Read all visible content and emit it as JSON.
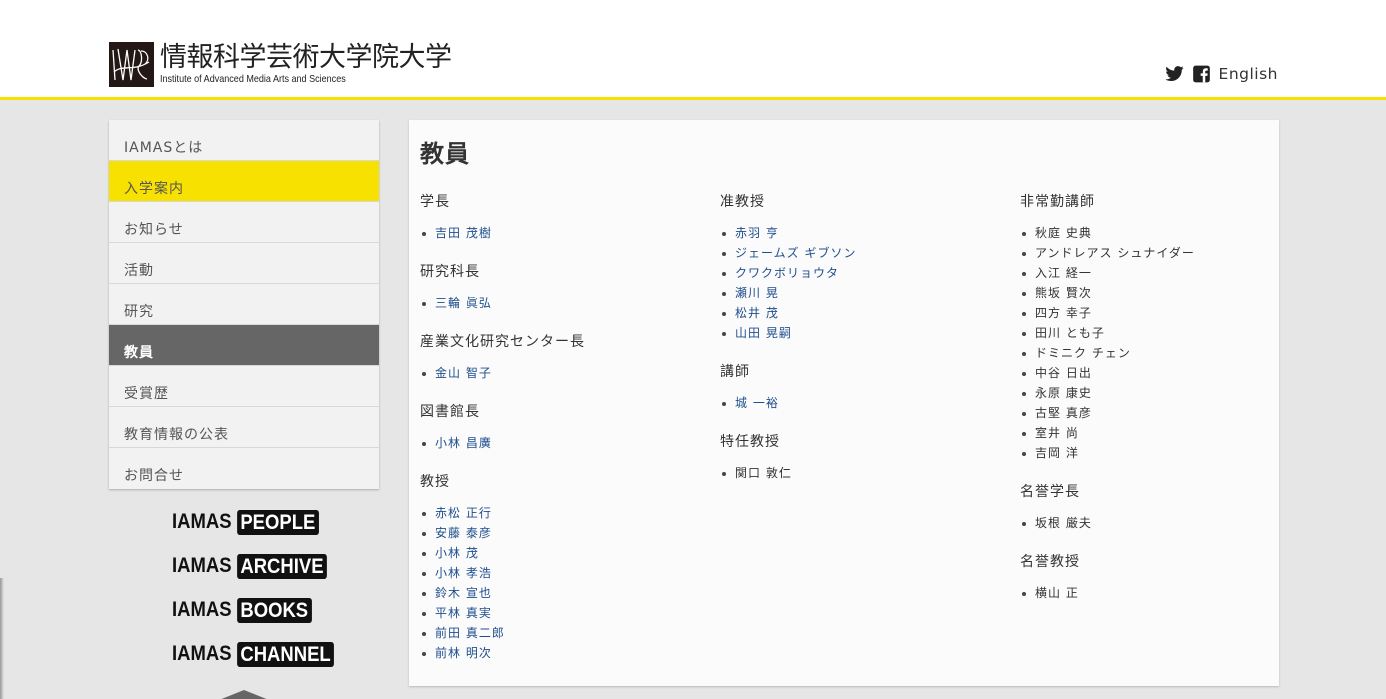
{
  "header": {
    "logo_jp": "情報科学芸術大学院大学",
    "logo_en": "Institute of Advanced Media Arts and Sciences",
    "english_link": "English",
    "icons": [
      "twitter-icon",
      "facebook-icon"
    ]
  },
  "sidebar": {
    "items": [
      {
        "label": "IAMASとは"
      },
      {
        "label": "入学案内"
      },
      {
        "label": "お知らせ"
      },
      {
        "label": "活動"
      },
      {
        "label": "研究"
      },
      {
        "label": "教員"
      },
      {
        "label": "受賞歴"
      },
      {
        "label": "教育情報の公表"
      },
      {
        "label": "お問合せ"
      }
    ],
    "highlight_color": "#f7e100",
    "active_color": "#666666"
  },
  "banners": [
    {
      "prefix": "IAMAS",
      "tag": "PEOPLE"
    },
    {
      "prefix": "IAMAS",
      "tag": "ARCHIVE"
    },
    {
      "prefix": "IAMAS",
      "tag": "BOOKS"
    },
    {
      "prefix": "IAMAS",
      "tag": "CHANNEL"
    }
  ],
  "main": {
    "title": "教員",
    "columns": [
      {
        "sections": [
          {
            "title": "学長",
            "members": [
              "吉田 茂樹"
            ]
          },
          {
            "title": "研究科長",
            "members": [
              "三輪 眞弘"
            ]
          },
          {
            "title": "産業文化研究センター長",
            "members": [
              "金山 智子"
            ]
          },
          {
            "title": "図書館長",
            "members": [
              "小林 昌廣"
            ]
          },
          {
            "title": "教授",
            "members": [
              "赤松 正行",
              "安藤 泰彦",
              "小林 茂",
              "小林 孝浩",
              "鈴木 宣也",
              "平林 真実",
              "前田 真二郎",
              "前林 明次"
            ]
          }
        ]
      },
      {
        "sections": [
          {
            "title": "准教授",
            "members": [
              "赤羽 亨",
              "ジェームズ ギブソン",
              "クワクボリョウタ",
              "瀬川 晃",
              "松井 茂",
              "山田 晃嗣"
            ]
          },
          {
            "title": "講師",
            "members": [
              "城 一裕"
            ]
          },
          {
            "title": "特任教授",
            "members": [
              "関口 敦仁"
            ]
          }
        ]
      },
      {
        "sections": [
          {
            "title": "非常勤講師",
            "members": [
              "秋庭 史典",
              "アンドレアス シュナイダー",
              "入江 経一",
              "熊坂 賢次",
              "四方 幸子",
              "田川 とも子",
              "ドミニク チェン",
              "中谷 日出",
              "永原 康史",
              "古堅 真彦",
              "室井 尚",
              "吉岡 洋"
            ]
          },
          {
            "title": "名誉学長",
            "members": [
              "坂根 厳夫"
            ]
          },
          {
            "title": "名誉教授",
            "members": [
              "横山 正"
            ]
          }
        ]
      }
    ]
  }
}
